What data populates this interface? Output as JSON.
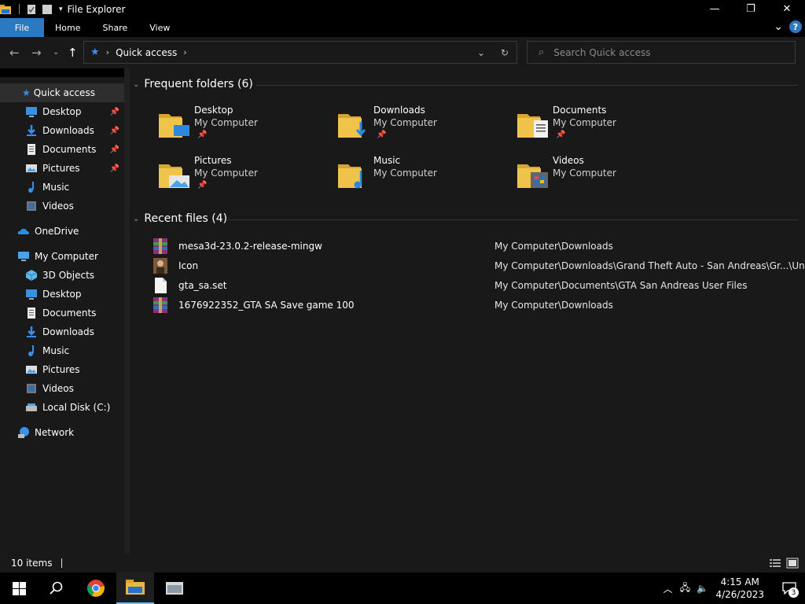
{
  "window": {
    "title": "File Explorer",
    "controls": {
      "minimize": "—",
      "maximize": "❐",
      "close": "✕"
    }
  },
  "ribbon": {
    "tabs": [
      "File",
      "Home",
      "Share",
      "View"
    ],
    "help": "?",
    "expand": "⌄"
  },
  "address": {
    "location": "Quick access",
    "search_placeholder": "Search Quick access"
  },
  "sidebar": {
    "quick_access": "Quick access",
    "qa_items": [
      {
        "label": "Desktop",
        "icon": "desktop-icon",
        "pinned": true
      },
      {
        "label": "Downloads",
        "icon": "downloads-icon",
        "pinned": true
      },
      {
        "label": "Documents",
        "icon": "documents-icon",
        "pinned": true
      },
      {
        "label": "Pictures",
        "icon": "pictures-icon",
        "pinned": true
      },
      {
        "label": "Music",
        "icon": "music-icon",
        "pinned": false
      },
      {
        "label": "Videos",
        "icon": "videos-icon",
        "pinned": false
      }
    ],
    "onedrive": "OneDrive",
    "my_computer": "My Computer",
    "mc_items": [
      {
        "label": "3D Objects",
        "icon": "3d-objects-icon"
      },
      {
        "label": "Desktop",
        "icon": "desktop-icon"
      },
      {
        "label": "Documents",
        "icon": "documents-icon"
      },
      {
        "label": "Downloads",
        "icon": "downloads-icon"
      },
      {
        "label": "Music",
        "icon": "music-icon"
      },
      {
        "label": "Pictures",
        "icon": "pictures-icon"
      },
      {
        "label": "Videos",
        "icon": "videos-icon"
      },
      {
        "label": "Local Disk (C:)",
        "icon": "local-disk-icon"
      }
    ],
    "network": "Network"
  },
  "content": {
    "frequent_header": "Frequent folders (6)",
    "folders": [
      {
        "name": "Desktop",
        "location": "My Computer",
        "pinned": true
      },
      {
        "name": "Downloads",
        "location": "My Computer",
        "pinned": true
      },
      {
        "name": "Documents",
        "location": "My Computer",
        "pinned": true
      },
      {
        "name": "Pictures",
        "location": "My Computer",
        "pinned": true
      },
      {
        "name": "Music",
        "location": "My Computer",
        "pinned": false
      },
      {
        "name": "Videos",
        "location": "My Computer",
        "pinned": false
      }
    ],
    "recent_header": "Recent files (4)",
    "recent_files": [
      {
        "name": "mesa3d-23.0.2-release-mingw",
        "path": "My Computer\\Downloads",
        "icon": "winrar-archive-icon"
      },
      {
        "name": "Icon",
        "path": "My Computer\\Downloads\\Grand Theft Auto - San Andreas\\Gr...\\Uninstall",
        "icon": "image-file-icon"
      },
      {
        "name": "gta_sa.set",
        "path": "My Computer\\Documents\\GTA San Andreas User Files",
        "icon": "blank-file-icon"
      },
      {
        "name": "1676922352_GTA SA Save game 100",
        "path": "My Computer\\Downloads",
        "icon": "winrar-archive-icon"
      }
    ]
  },
  "status": {
    "item_count": "10 items"
  },
  "taskbar": {
    "time": "4:15 AM",
    "date": "4/26/2023",
    "notifications": "3"
  }
}
